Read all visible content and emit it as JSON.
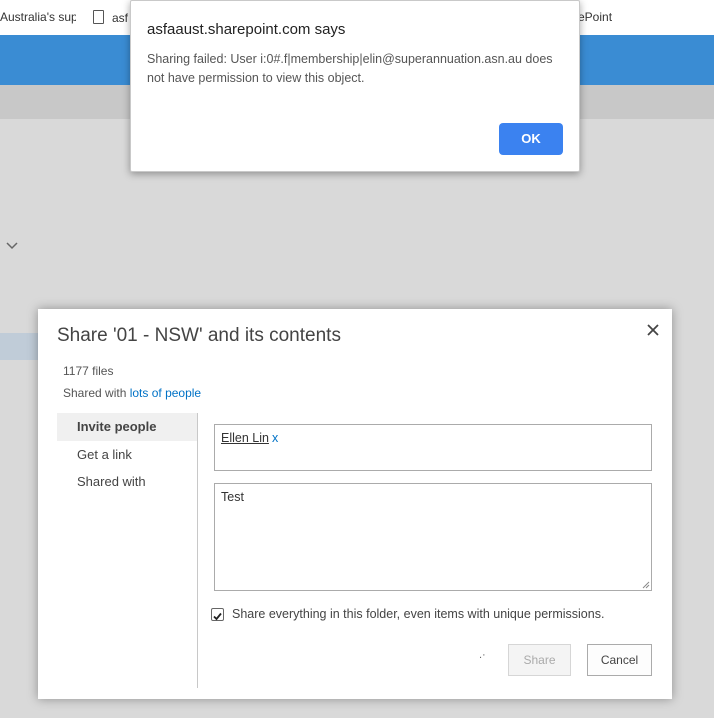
{
  "browser": {
    "bookmarks": [
      {
        "label": "Australia's sup"
      },
      {
        "label": "asf"
      },
      {
        "label": "ePoint"
      }
    ]
  },
  "alert": {
    "title": "asfaaust.sharepoint.com says",
    "message": "Sharing failed: User i:0#.f|membership|elin@superannuation.asn.au does not have permission to view this object.",
    "ok_label": "OK"
  },
  "share_dialog": {
    "title": "Share '01 - NSW' and its contents",
    "files_count": "1177 files",
    "shared_with_prefix": "Shared with",
    "shared_with_link": "lots of people",
    "nav": [
      {
        "label": "Invite people",
        "active": true
      },
      {
        "label": "Get a link",
        "active": false
      },
      {
        "label": "Shared with",
        "active": false
      }
    ],
    "invitee": {
      "name": "Ellen Lin",
      "remove": "x"
    },
    "message_text": "Test",
    "share_all_label": "Share everything in this folder, even items with unique permissions.",
    "share_all_checked": true,
    "share_label": "Share",
    "cancel_label": "Cancel"
  },
  "colors": {
    "suite_bar": "#3a8cd3",
    "ok_button": "#3b82f0",
    "link": "#0072c6"
  }
}
